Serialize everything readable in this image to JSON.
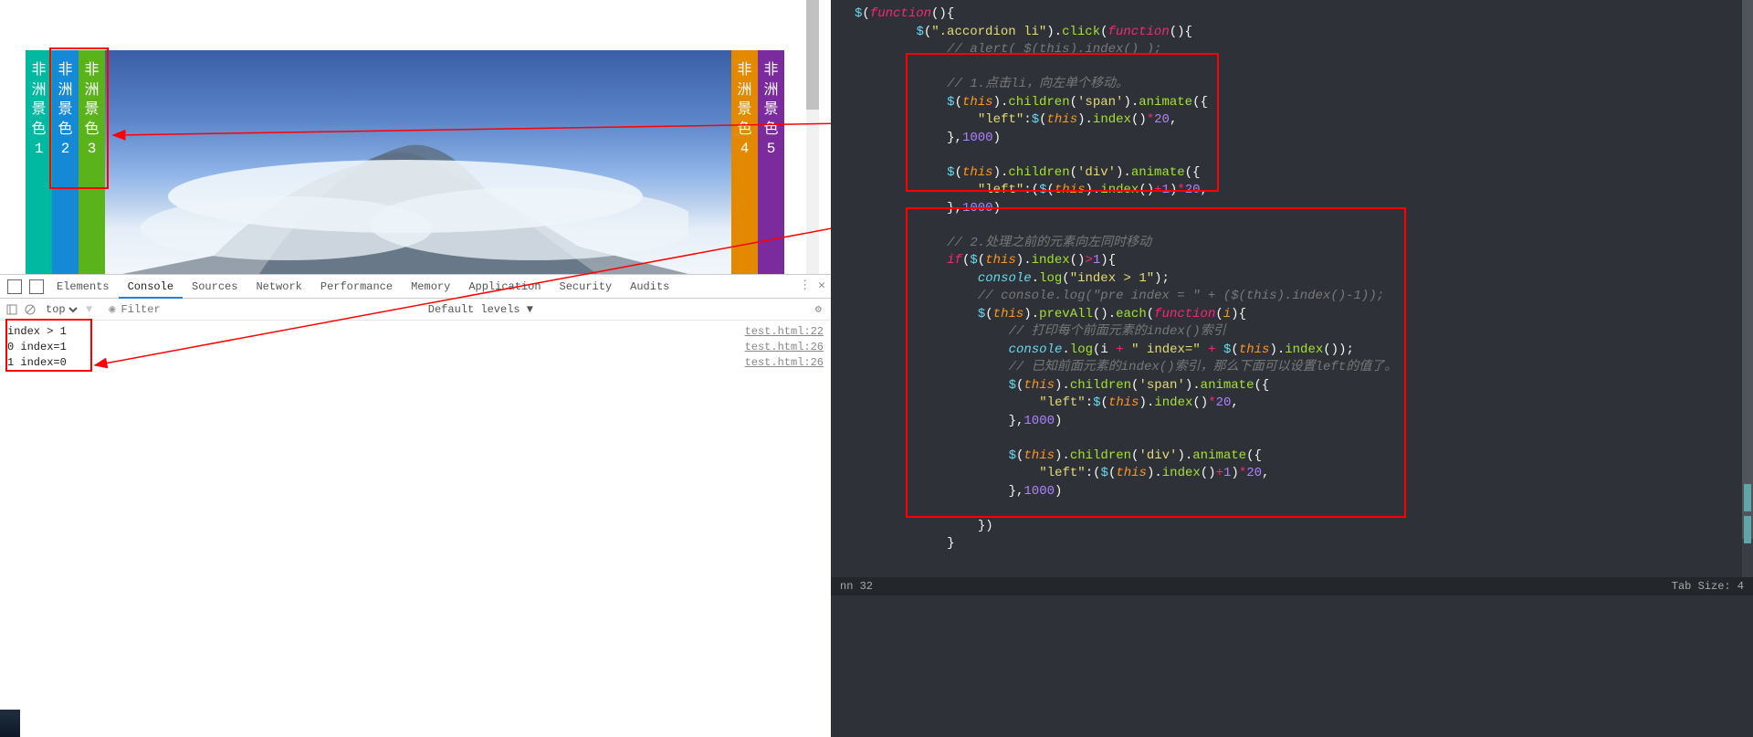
{
  "preview": {
    "tabs": [
      {
        "label": "非洲景色",
        "num": "1"
      },
      {
        "label": "非洲景色",
        "num": "2"
      },
      {
        "label": "非洲景色",
        "num": "3"
      },
      {
        "label": "非洲景色",
        "num": "4"
      },
      {
        "label": "非洲景色",
        "num": "5"
      }
    ]
  },
  "devtools": {
    "tabs": [
      "Elements",
      "Console",
      "Sources",
      "Network",
      "Performance",
      "Memory",
      "Application",
      "Security",
      "Audits"
    ],
    "active_tab": "Console",
    "context": "top",
    "filter_placeholder": "Filter",
    "levels_label": "Default levels ▼",
    "rows": [
      {
        "msg": "index > 1",
        "src": "test.html:22"
      },
      {
        "msg": "0 index=1",
        "src": "test.html:26"
      },
      {
        "msg": "1 index=0",
        "src": "test.html:26"
      }
    ]
  },
  "code": {
    "t": {
      "funcdecl": "$(function(){",
      "sel_click": "        $(\".accordion li\").click(function(){",
      "alert_cm": "            // alert( $(this).index() );",
      "blk1_cm": "            // 1.点击li，向左单个移动。",
      "blk1_l1a": "            $(this).children('span').animate({",
      "blk1_l2": "                \"left\":$(this).index()*20,",
      "blk1_l3": "            },1000)",
      "blk1_l4": "            $(this).children('div').animate({",
      "blk1_l5": "                \"left\":($(this).index()+1)*20,",
      "blk1_l6": "            },1000)",
      "blk2_cm": "            // 2.处理之前的元素向左同时移动",
      "blk2_if": "            if($(this).index()>1){",
      "blk2_log1": "                console.log(\"index > 1\");",
      "blk2_cm2": "                // console.log(\"pre index = \" + ($(this).index()-1));",
      "blk2_each": "                $(this).prevAll().each(function(i){",
      "blk2_cm3": "                    // 打印每个前面元素的index()索引",
      "blk2_log2": "                    console.log(i + \" index=\" + $(this).index());",
      "blk2_cm4": "                    // 已知前面元素的index()索引，那么下面可以设置left的值了。",
      "blk2_a1": "                    $(this).children('span').animate({",
      "blk2_a2": "                        \"left\":$(this).index()*20,",
      "blk2_a3": "                    },1000)",
      "blk2_a4": "                    $(this).children('div').animate({",
      "blk2_a5": "                        \"left\":($(this).index()+1)*20,",
      "blk2_a6": "                    },1000)",
      "blk2_eachend": "                })",
      "blk2_ifend": "            }",
      "clickend": "        })",
      "funcend": "    })"
    }
  },
  "status": {
    "col": "nn 32",
    "tab": "Tab Size: 4"
  }
}
